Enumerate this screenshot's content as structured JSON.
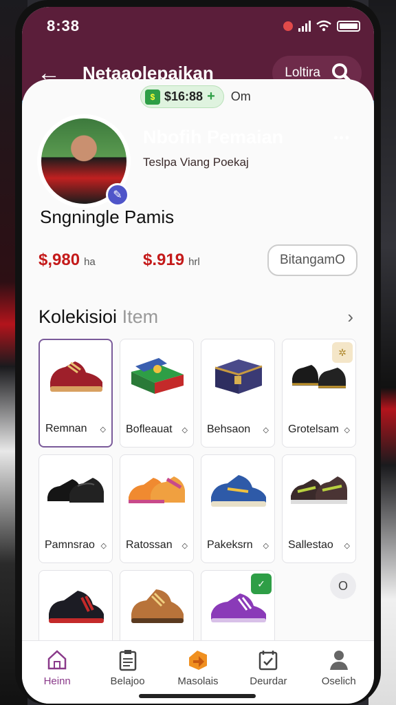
{
  "status": {
    "time": "8:38"
  },
  "appbar": {
    "title": "Netaaolepaikan",
    "pill_label": "Loltira"
  },
  "profile": {
    "name": "Nbofih Pemaian",
    "subtitle": "Teslpa Viang Poekaj",
    "coins": "$16:88",
    "extra": "Om"
  },
  "single": {
    "title": "Sngningle Pamis",
    "price1": "$,980",
    "price1_unit": "ha",
    "price2": "$.919",
    "price2_unit": "hrl",
    "button": "BitangamO"
  },
  "collection": {
    "title_main": "Kolekisioi",
    "title_muted": " Item",
    "items": [
      {
        "label": "Remnan",
        "icon": "red-shoe-icon"
      },
      {
        "label": "Bofleauat",
        "icon": "gift-box-icon"
      },
      {
        "label": "Behsaon",
        "icon": "chest-icon"
      },
      {
        "label": "Grotelsam",
        "icon": "black-boots-icon"
      },
      {
        "label": "Pamnsrao",
        "icon": "black-dress-shoe-icon"
      },
      {
        "label": "Ratossan",
        "icon": "orange-sneaker-icon"
      },
      {
        "label": "Pakeksrn",
        "icon": "blue-sneaker-icon"
      },
      {
        "label": "Sallestao",
        "icon": "brown-sneaker-icon"
      },
      {
        "label": "",
        "icon": "black-red-sneaker-icon"
      },
      {
        "label": "",
        "icon": "tan-boot-icon"
      },
      {
        "label": "",
        "icon": "purple-sneaker-icon"
      }
    ],
    "empty_marker": "O"
  },
  "nav": [
    {
      "label": "Heinn",
      "icon": "home-icon"
    },
    {
      "label": "Belajoo",
      "icon": "clipboard-icon"
    },
    {
      "label": "Masolais",
      "icon": "market-icon"
    },
    {
      "label": "Deurdar",
      "icon": "calendar-icon"
    },
    {
      "label": "Oselich",
      "icon": "profile-icon"
    }
  ]
}
